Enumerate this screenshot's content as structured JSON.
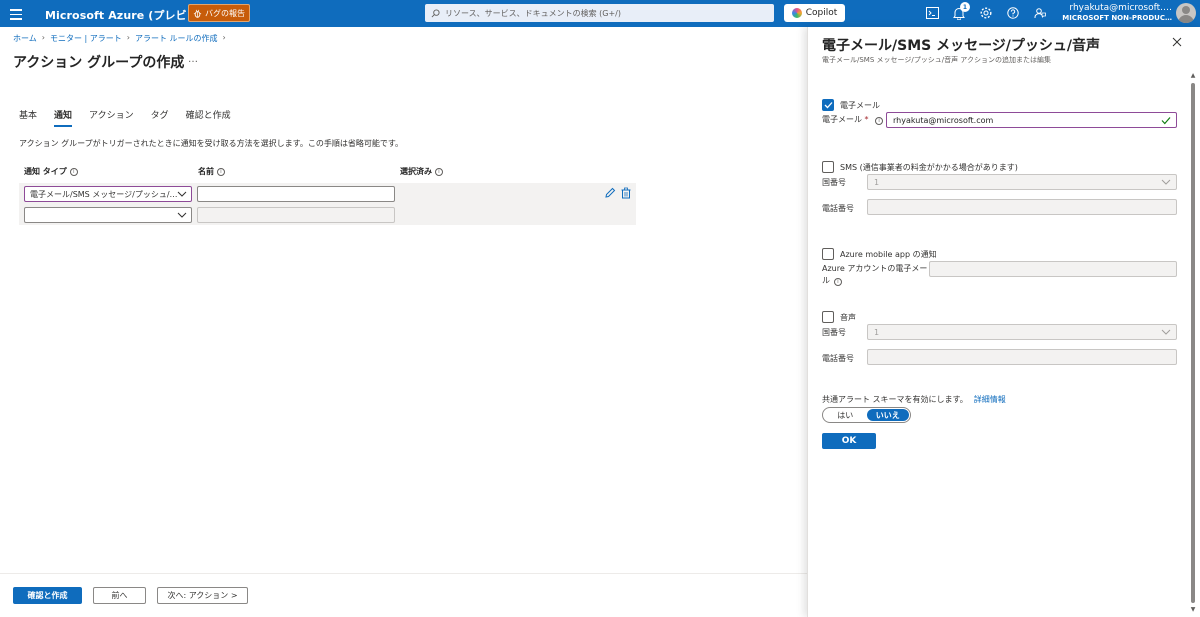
{
  "topbar": {
    "brand": "Microsoft Azure (プレビュー)",
    "bug_report": "バグの報告",
    "search_placeholder": "リソース、サービス、ドキュメントの検索 (G+/)",
    "copilot": "Copilot",
    "notification_count": "1",
    "user": "rhyakuta@microsoft.…",
    "tenant": "MICROSOFT NON-PRODUC…"
  },
  "breadcrumb": [
    "ホーム",
    "モニター | アラート",
    "アラート ルールの作成"
  ],
  "page": {
    "title": "アクション グループの作成",
    "more": "…",
    "tabs": [
      {
        "label": "基本",
        "active": false
      },
      {
        "label": "通知",
        "active": true
      },
      {
        "label": "アクション",
        "active": false
      },
      {
        "label": "タグ",
        "active": false
      },
      {
        "label": "確認と作成",
        "active": false
      }
    ],
    "description": "アクション グループがトリガーされたときに通知を受け取る方法を選択します。この手順は省略可能です。",
    "columns": {
      "type": "通知 タイプ",
      "name": "名前",
      "selected": "選択済み"
    },
    "rows": [
      {
        "type": "電子メール/SMS メッセージ/プッシュ/…",
        "name": ""
      },
      {
        "type": "",
        "name": ""
      }
    ]
  },
  "footer": {
    "review_create": "確認と作成",
    "previous": "前へ",
    "next": "次へ: アクション >"
  },
  "panel": {
    "title": "電子メール/SMS メッセージ/プッシュ/音声",
    "subtitle": "電子メール/SMS メッセージ/プッシュ/音声 アクションの追加または編集",
    "email": {
      "checkbox_label": "電子メール",
      "checked": true,
      "field_label": "電子メール",
      "required_mark": "*",
      "value": "rhyakuta@microsoft.com"
    },
    "sms": {
      "checkbox_label": "SMS (通信事業者の料金がかかる場合があります)",
      "checked": false,
      "country_label": "国番号",
      "country_value": "1",
      "phone_label": "電話番号"
    },
    "mobile_app": {
      "checkbox_label": "Azure mobile app の通知",
      "checked": false,
      "field_label_1": "Azure アカウントの電子メー",
      "field_label_2": "ル"
    },
    "voice": {
      "checkbox_label": "音声",
      "checked": false,
      "country_label": "国番号",
      "country_value": "1",
      "phone_label": "電話番号"
    },
    "schema": {
      "text": "共通アラート スキーマを有効にします。",
      "link": "詳細情報",
      "yes": "はい",
      "no": "いいえ",
      "selected": "いいえ"
    },
    "ok": "OK"
  },
  "colors": {
    "brand_blue": "#0f6cbd",
    "bug_orange": "#c75c0a",
    "focus_border": "#8e4b98",
    "valid_green": "#107c10"
  }
}
